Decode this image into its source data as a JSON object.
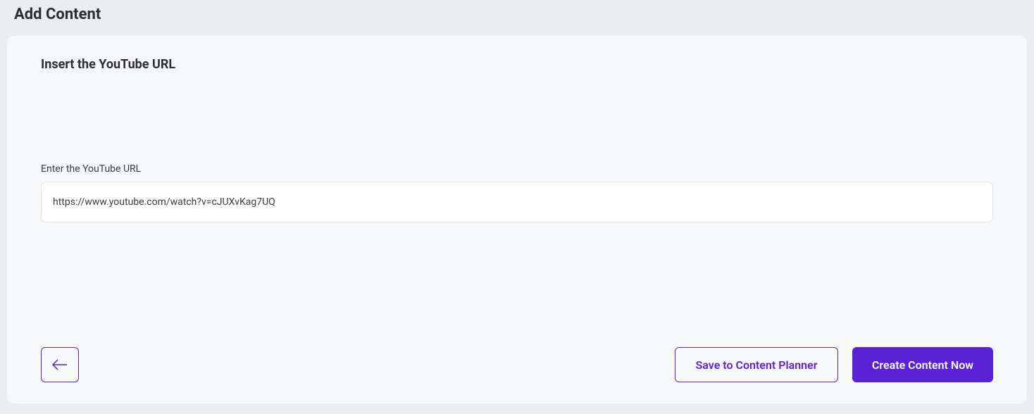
{
  "header": {
    "title": "Add Content"
  },
  "section": {
    "title": "Insert the YouTube URL"
  },
  "form": {
    "url_label": "Enter the YouTube URL",
    "url_value": "https://www.youtube.com/watch?v=cJUXvKag7UQ"
  },
  "footer": {
    "save_label": "Save to Content Planner",
    "create_label": "Create Content Now"
  }
}
